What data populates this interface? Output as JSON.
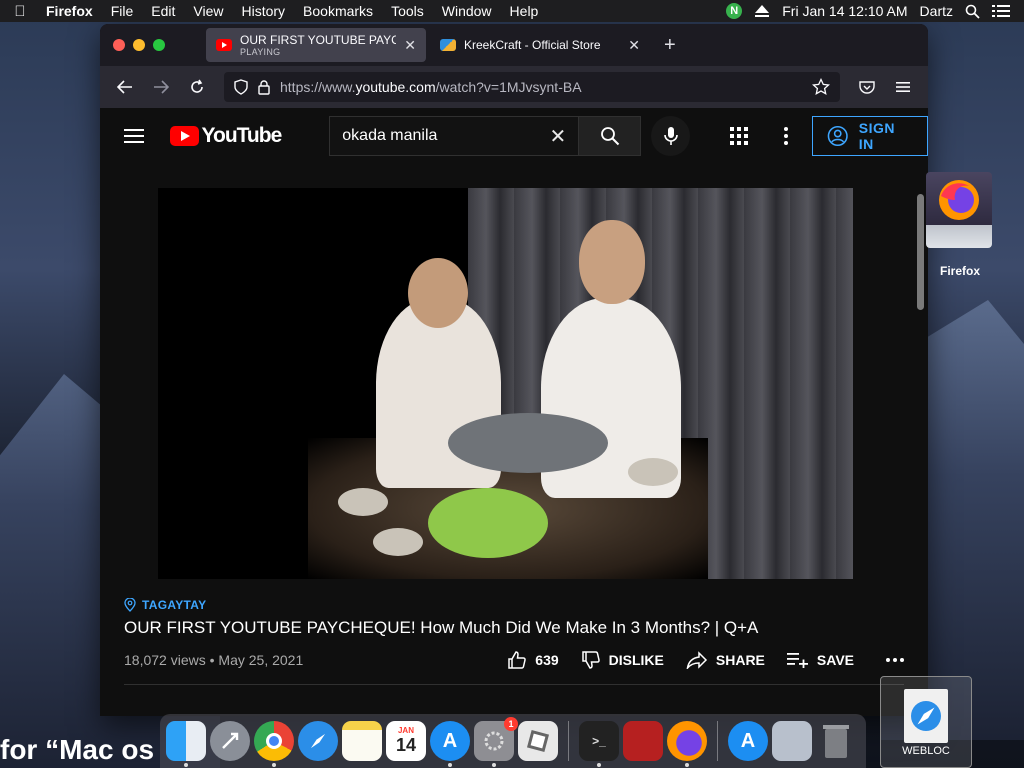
{
  "menubar": {
    "app_name": "Firefox",
    "items": [
      "File",
      "Edit",
      "View",
      "History",
      "Bookmarks",
      "Tools",
      "Window",
      "Help"
    ],
    "status_badge": "N",
    "datetime": "Fri Jan 14  12:10 AM",
    "user": "Dartz"
  },
  "browser": {
    "tabs": [
      {
        "title": "OUR FIRST YOUTUBE PAYCHEQUE!",
        "subtitle": "PLAYING",
        "favicon": "youtube-icon",
        "active": true
      },
      {
        "title": "KreekCraft - Official Store",
        "subtitle": "",
        "favicon": "kreekcraft-icon",
        "active": false
      }
    ],
    "url": {
      "prefix": "https://www.",
      "host": "youtube.com",
      "path": "/watch?v=1MJvsynt-BA"
    }
  },
  "youtube": {
    "logo_text": "YouTube",
    "search_value": "okada manila",
    "sign_in_label": "SIGN IN",
    "video": {
      "location": "TAGAYTAY",
      "title": "OUR FIRST YOUTUBE PAYCHEQUE! How Much Did We Make In 3 Months? | Q+A",
      "views": "18,072 views",
      "date": "May 25, 2021",
      "likes": "639",
      "dislike_label": "DISLIKE",
      "share_label": "SHARE",
      "save_label": "SAVE"
    }
  },
  "desktop": {
    "icon_label": "Firefox",
    "bottom_text": "for “Mac os",
    "webloc_label": "WEBLOC"
  },
  "dock": {
    "calendar_month": "JAN",
    "calendar_day": "14",
    "system_prefs_badge": "1"
  },
  "colors": {
    "accent_blue": "#3ea6ff",
    "youtube_red": "#ff0000",
    "page_bg": "#0f0f0f"
  }
}
